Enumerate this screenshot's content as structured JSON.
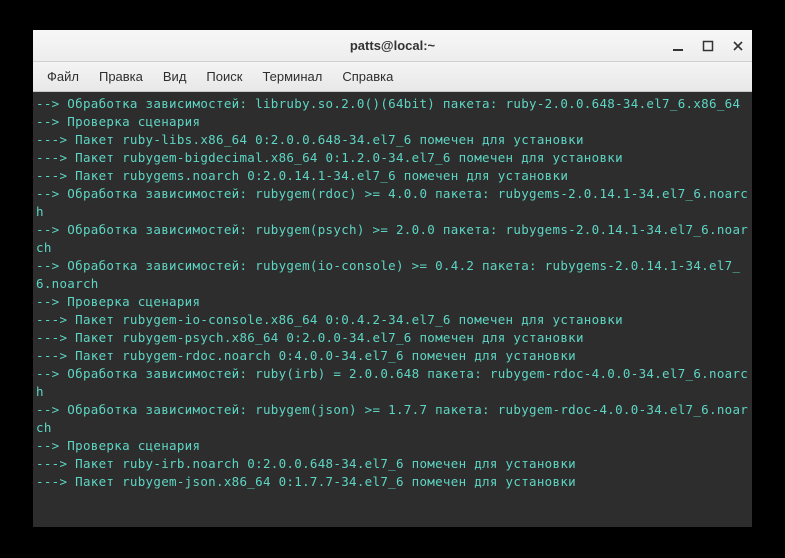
{
  "window": {
    "title": "patts@local:~"
  },
  "menubar": {
    "items": [
      {
        "label": "Файл"
      },
      {
        "label": "Правка"
      },
      {
        "label": "Вид"
      },
      {
        "label": "Поиск"
      },
      {
        "label": "Терминал"
      },
      {
        "label": "Справка"
      }
    ]
  },
  "terminal": {
    "lines": [
      "--> Обработка зависимостей: libruby.so.2.0()(64bit) пакета: ruby-2.0.0.648-34.el7_6.x86_64",
      "--> Проверка сценария",
      "---> Пакет ruby-libs.x86_64 0:2.0.0.648-34.el7_6 помечен для установки",
      "---> Пакет rubygem-bigdecimal.x86_64 0:1.2.0-34.el7_6 помечен для установки",
      "---> Пакет rubygems.noarch 0:2.0.14.1-34.el7_6 помечен для установки",
      "--> Обработка зависимостей: rubygem(rdoc) >= 4.0.0 пакета: rubygems-2.0.14.1-34.el7_6.noarch",
      "--> Обработка зависимостей: rubygem(psych) >= 2.0.0 пакета: rubygems-2.0.14.1-34.el7_6.noarch",
      "--> Обработка зависимостей: rubygem(io-console) >= 0.4.2 пакета: rubygems-2.0.14.1-34.el7_6.noarch",
      "--> Проверка сценария",
      "---> Пакет rubygem-io-console.x86_64 0:0.4.2-34.el7_6 помечен для установки",
      "---> Пакет rubygem-psych.x86_64 0:2.0.0-34.el7_6 помечен для установки",
      "---> Пакет rubygem-rdoc.noarch 0:4.0.0-34.el7_6 помечен для установки",
      "--> Обработка зависимостей: ruby(irb) = 2.0.0.648 пакета: rubygem-rdoc-4.0.0-34.el7_6.noarch",
      "--> Обработка зависимостей: rubygem(json) >= 1.7.7 пакета: rubygem-rdoc-4.0.0-34.el7_6.noarch",
      "--> Проверка сценария",
      "---> Пакет ruby-irb.noarch 0:2.0.0.648-34.el7_6 помечен для установки",
      "---> Пакет rubygem-json.x86_64 0:1.7.7-34.el7_6 помечен для установки"
    ]
  }
}
